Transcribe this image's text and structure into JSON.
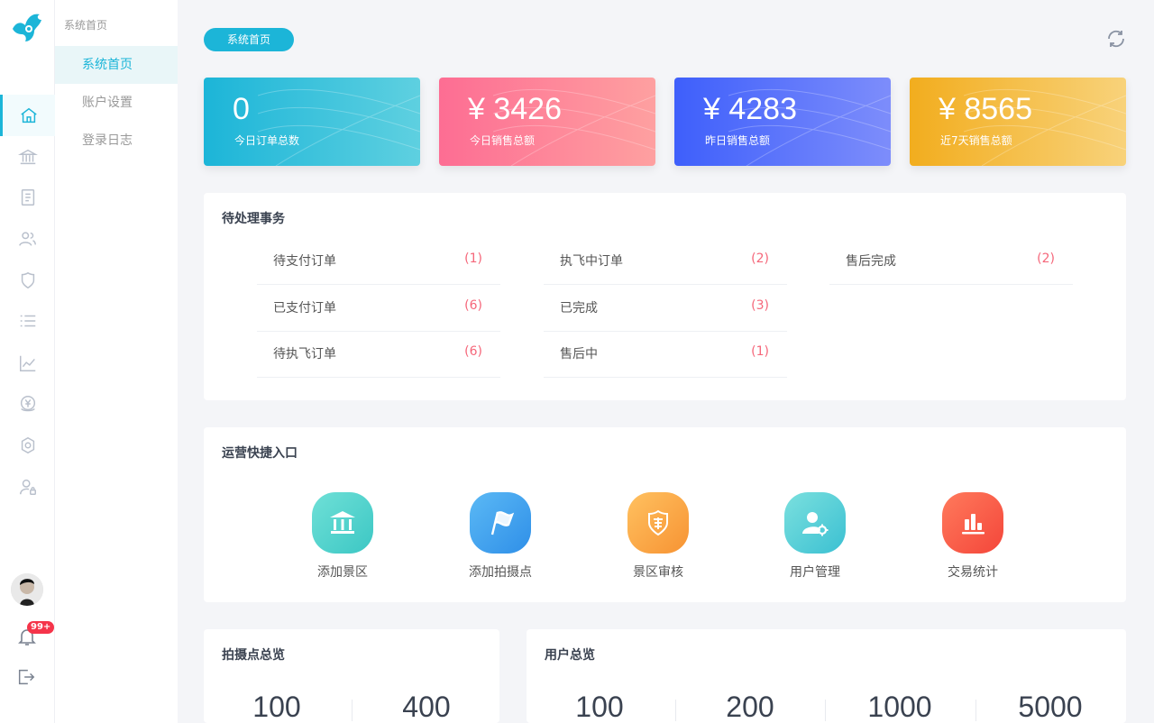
{
  "colors": {
    "accent": "#1cb5d8",
    "danger": "#f5677a",
    "rail_icon": "#b9c0cc"
  },
  "rail": {
    "icons": [
      "home-icon",
      "bank-icon",
      "document-icon",
      "users-icon",
      "shield-icon",
      "list-icon",
      "chart-icon",
      "money-icon",
      "settings-icon",
      "user-lock-icon"
    ],
    "badge": "99+"
  },
  "subnav": {
    "title": "系统首页",
    "items": [
      "系统首页",
      "账户设置",
      "登录日志"
    ]
  },
  "header": {
    "pill": "系统首页"
  },
  "stats": [
    {
      "value": "0",
      "label": "今日订单总数"
    },
    {
      "value": "¥ 3426",
      "label": "今日销售总额"
    },
    {
      "value": "¥ 4283",
      "label": "昨日销售总额"
    },
    {
      "value": "¥ 8565",
      "label": "近7天销售总额"
    }
  ],
  "pending": {
    "title": "待处理事务",
    "items": [
      {
        "name": "待支付订单",
        "count": "(1)"
      },
      {
        "name": "执飞中订单",
        "count": "(2)"
      },
      {
        "name": "售后完成",
        "count": "(2)"
      },
      {
        "name": "已支付订单",
        "count": "(6)"
      },
      {
        "name": "已完成",
        "count": "(3)"
      },
      {
        "name": "待执飞订单",
        "count": "(6)"
      },
      {
        "name": "售后中",
        "count": "(1)"
      }
    ]
  },
  "shortcuts": {
    "title": "运营快捷入口",
    "items": [
      {
        "label": "添加景区",
        "icon": "scenic-area-icon"
      },
      {
        "label": "添加拍摄点",
        "icon": "flag-icon"
      },
      {
        "label": "景区审核",
        "icon": "audit-shield-icon"
      },
      {
        "label": "用户管理",
        "icon": "user-settings-icon"
      },
      {
        "label": "交易统计",
        "icon": "bar-stats-icon"
      }
    ]
  },
  "shoot_overview": {
    "title": "拍摄点总览",
    "values": [
      "100",
      "400"
    ]
  },
  "user_overview": {
    "title": "用户总览",
    "values": [
      "100",
      "200",
      "1000",
      "5000"
    ]
  }
}
